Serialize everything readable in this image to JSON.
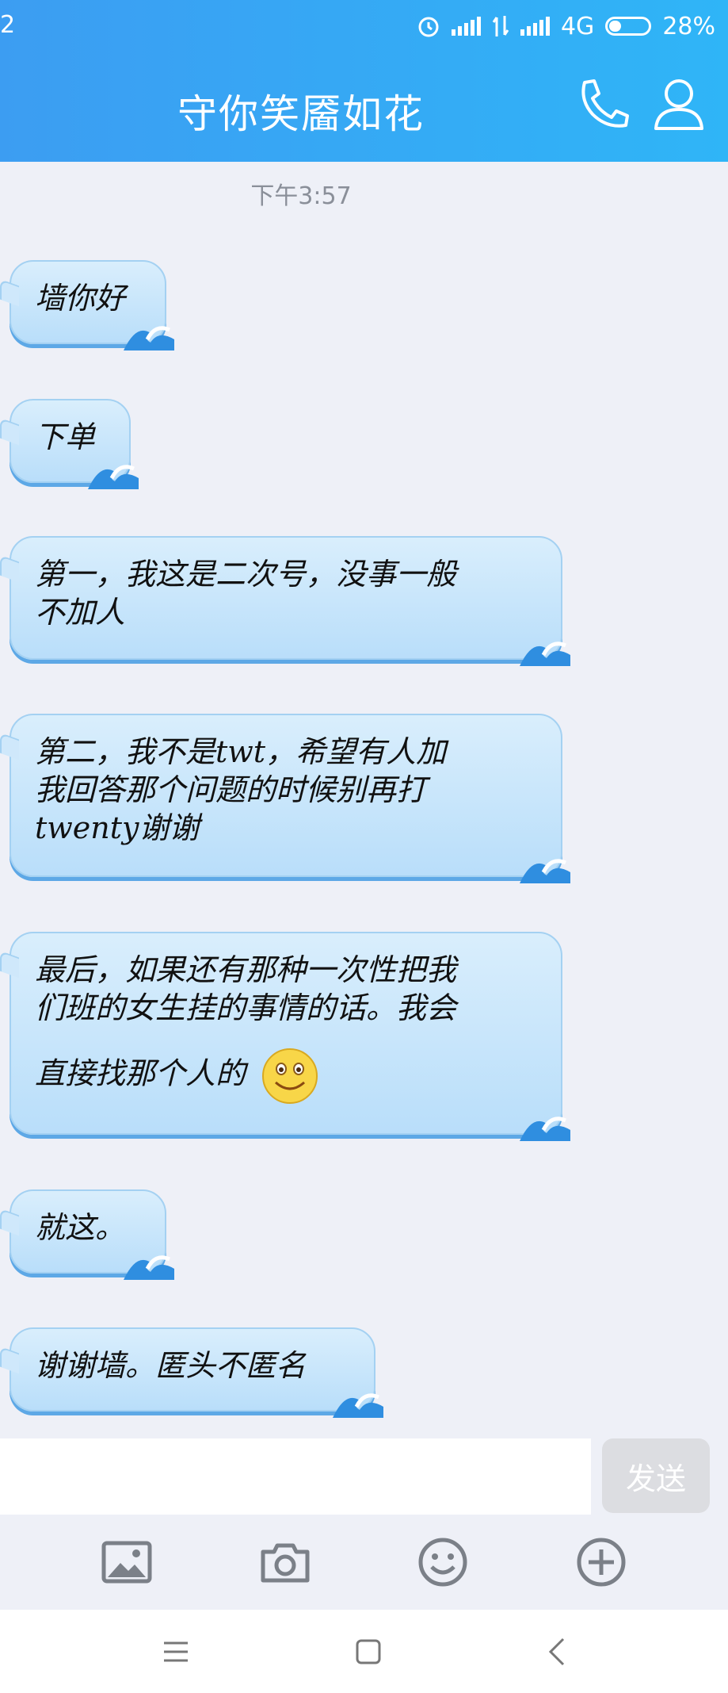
{
  "status_bar": {
    "left_text": "2",
    "network": "4G",
    "battery": "28%"
  },
  "header": {
    "title": "守你笑靥如花"
  },
  "timestamp": "下午3:57",
  "messages": [
    {
      "lines": [
        "墙你好"
      ]
    },
    {
      "lines": [
        "下单"
      ]
    },
    {
      "lines": [
        "第一，我这是二次号，没事一般",
        "不加人"
      ]
    },
    {
      "lines": [
        "第二，我不是twt，希望有人加",
        "我回答那个问题的时候别再打",
        "twenty谢谢"
      ]
    },
    {
      "lines": [
        "最后，如果还有那种一次性把我",
        "们班的女生挂的事情的话。我会",
        "直接找那个人的"
      ]
    },
    {
      "lines": [
        "就这。"
      ]
    },
    {
      "lines": [
        "谢谢墙。匿头不匿名"
      ]
    }
  ],
  "input": {
    "send_label": "发送"
  },
  "icons": {
    "alarm": "alarm-icon",
    "signal": "signal-icon",
    "data": "data-transfer-icon",
    "battery": "battery-icon",
    "call": "phone-icon",
    "profile": "person-icon",
    "image": "image-icon",
    "camera": "camera-icon",
    "emoji": "emoji-icon",
    "plus": "plus-icon",
    "menu": "menu-icon",
    "home": "home-icon",
    "back": "back-icon",
    "smiley": "smiley-icon"
  },
  "colors": {
    "header_start": "#3c9df2",
    "header_end": "#2fb5f7",
    "bubble": "#c6e5fb",
    "background": "#eef0f7"
  }
}
